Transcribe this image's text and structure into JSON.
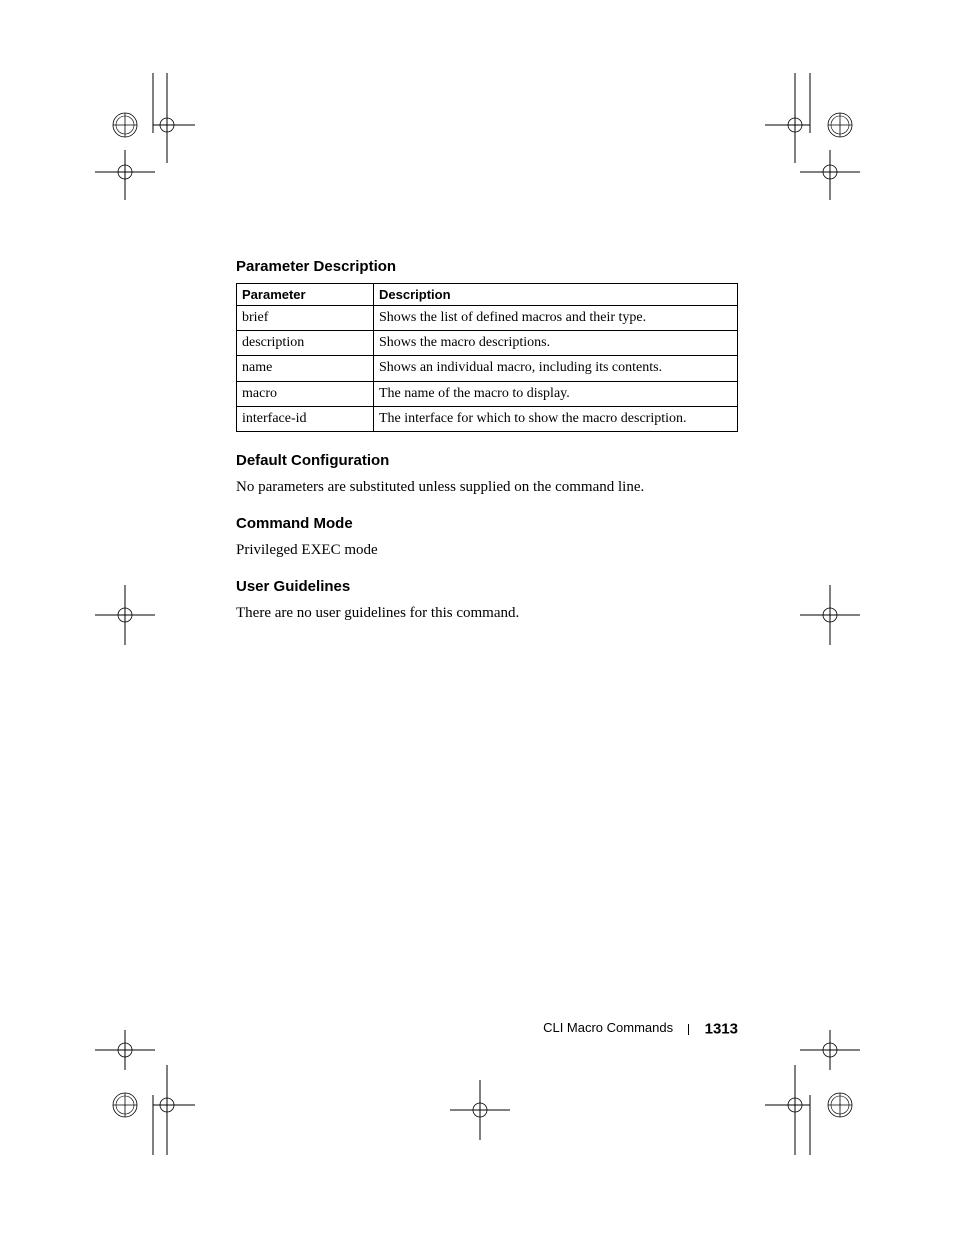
{
  "sections": {
    "param_desc_heading": "Parameter Description",
    "table": {
      "headers": {
        "c1": "Parameter",
        "c2": "Description"
      },
      "rows": [
        {
          "p": "brief",
          "d": "Shows the list of defined macros and their type."
        },
        {
          "p": "description",
          "d": "Shows the macro descriptions."
        },
        {
          "p": "name",
          "d": "Shows an individual macro, including its contents."
        },
        {
          "p": "macro",
          "d": "The name of the macro to display."
        },
        {
          "p": "interface-id",
          "d": "The interface for which to show the macro description."
        }
      ]
    },
    "default_cfg_heading": "Default Configuration",
    "default_cfg_body": "No parameters are substituted unless supplied on the command line.",
    "cmd_mode_heading": "Command Mode",
    "cmd_mode_body": "Privileged EXEC mode",
    "user_guidelines_heading": "User Guidelines",
    "user_guidelines_body": "There are no user guidelines for this command."
  },
  "footer": {
    "title": "CLI Macro Commands",
    "page": "1313"
  }
}
